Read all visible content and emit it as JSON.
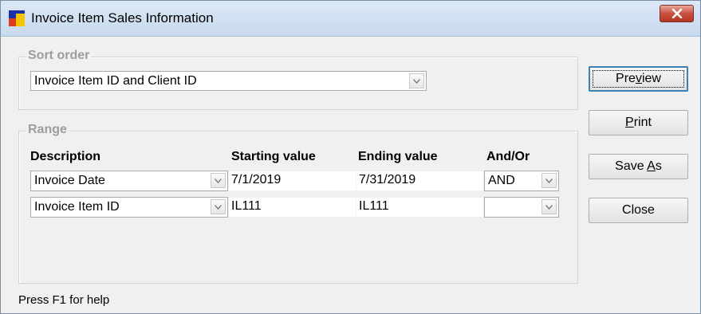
{
  "window": {
    "title": "Invoice Item Sales Information"
  },
  "sort_order": {
    "legend": "Sort order",
    "selected": "Invoice Item ID and Client ID"
  },
  "range": {
    "legend": "Range",
    "headers": {
      "description": "Description",
      "starting": "Starting value",
      "ending": "Ending value",
      "andor": "And/Or"
    },
    "rows": [
      {
        "description": "Invoice Date",
        "starting": "7/1/2019",
        "ending": "7/31/2019",
        "andor": "AND"
      },
      {
        "description": "Invoice Item ID",
        "starting": "IL111",
        "ending": "IL111",
        "andor": ""
      }
    ]
  },
  "buttons": {
    "preview": {
      "pre": "Pre",
      "u": "v",
      "post": "iew"
    },
    "print": {
      "pre": "",
      "u": "P",
      "post": "rint"
    },
    "save_as": {
      "pre": "Save ",
      "u": "A",
      "post": "s"
    },
    "close": {
      "pre": "Close",
      "u": "",
      "post": ""
    }
  },
  "status_text": "Press F1 for help",
  "icons": {
    "app": "app-icon",
    "close": "close-icon",
    "dropdown": "chevron-down-icon"
  },
  "colors": {
    "titlebar": "#c8daef",
    "close_button": "#c8503f",
    "default_button_border": "#3c7fb1"
  }
}
